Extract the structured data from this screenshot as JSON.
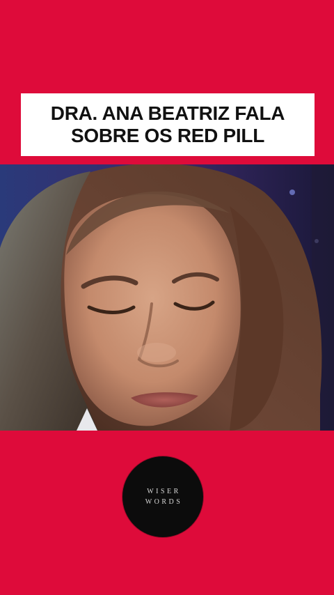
{
  "caption": {
    "line1": "DRA. ANA BEATRIZ FALA",
    "line2": "SOBRE OS RED PILL"
  },
  "video": {
    "subject": "woman-face-closeup"
  },
  "logo": {
    "line1": "WISER",
    "line2": "WORDS"
  },
  "colors": {
    "background": "#de0b3a",
    "caption_box": "#ffffff",
    "caption_text": "#111111",
    "logo_circle": "#0c0c0c",
    "logo_text": "#d8d8d8"
  }
}
